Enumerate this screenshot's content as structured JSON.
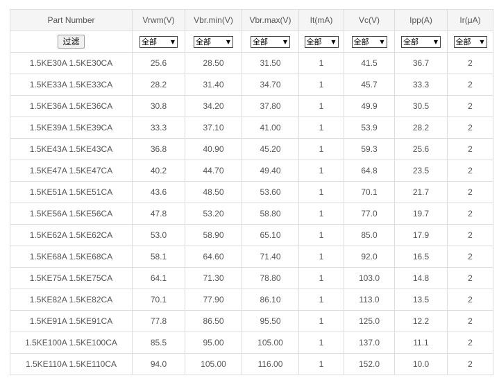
{
  "headers": [
    "Part Number",
    "Vrwm(V)",
    "Vbr.min(V)",
    "Vbr.max(V)",
    "It(mA)",
    "Vc(V)",
    "Ipp(A)",
    "Ir(μA)"
  ],
  "filter_button": "过滤",
  "filter_selects": [
    "全部",
    "全部",
    "全部",
    "全部",
    "全部",
    "全部",
    "全部"
  ],
  "rows": [
    [
      "1.5KE30A 1.5KE30CA",
      "25.6",
      "28.50",
      "31.50",
      "1",
      "41.5",
      "36.7",
      "2"
    ],
    [
      "1.5KE33A 1.5KE33CA",
      "28.2",
      "31.40",
      "34.70",
      "1",
      "45.7",
      "33.3",
      "2"
    ],
    [
      "1.5KE36A 1.5KE36CA",
      "30.8",
      "34.20",
      "37.80",
      "1",
      "49.9",
      "30.5",
      "2"
    ],
    [
      "1.5KE39A 1.5KE39CA",
      "33.3",
      "37.10",
      "41.00",
      "1",
      "53.9",
      "28.2",
      "2"
    ],
    [
      "1.5KE43A 1.5KE43CA",
      "36.8",
      "40.90",
      "45.20",
      "1",
      "59.3",
      "25.6",
      "2"
    ],
    [
      "1.5KE47A 1.5KE47CA",
      "40.2",
      "44.70",
      "49.40",
      "1",
      "64.8",
      "23.5",
      "2"
    ],
    [
      "1.5KE51A 1.5KE51CA",
      "43.6",
      "48.50",
      "53.60",
      "1",
      "70.1",
      "21.7",
      "2"
    ],
    [
      "1.5KE56A 1.5KE56CA",
      "47.8",
      "53.20",
      "58.80",
      "1",
      "77.0",
      "19.7",
      "2"
    ],
    [
      "1.5KE62A 1.5KE62CA",
      "53.0",
      "58.90",
      "65.10",
      "1",
      "85.0",
      "17.9",
      "2"
    ],
    [
      "1.5KE68A 1.5KE68CA",
      "58.1",
      "64.60",
      "71.40",
      "1",
      "92.0",
      "16.5",
      "2"
    ],
    [
      "1.5KE75A 1.5KE75CA",
      "64.1",
      "71.30",
      "78.80",
      "1",
      "103.0",
      "14.8",
      "2"
    ],
    [
      "1.5KE82A 1.5KE82CA",
      "70.1",
      "77.90",
      "86.10",
      "1",
      "113.0",
      "13.5",
      "2"
    ],
    [
      "1.5KE91A 1.5KE91CA",
      "77.8",
      "86.50",
      "95.50",
      "1",
      "125.0",
      "12.2",
      "2"
    ],
    [
      "1.5KE100A 1.5KE100CA",
      "85.5",
      "95.00",
      "105.00",
      "1",
      "137.0",
      "11.1",
      "2"
    ],
    [
      "1.5KE110A 1.5KE110CA",
      "94.0",
      "105.00",
      "116.00",
      "1",
      "152.0",
      "10.0",
      "2"
    ]
  ],
  "colors": {
    "header_bg": "#f5f5f5",
    "border": "#dddddd",
    "text": "#555555"
  },
  "icons": {
    "select_arrow": "triangle-down"
  }
}
